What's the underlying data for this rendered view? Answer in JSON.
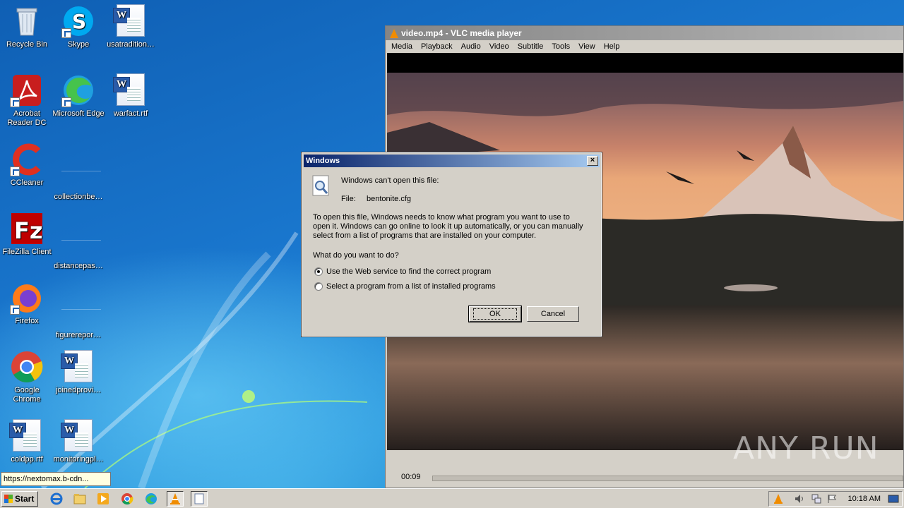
{
  "desktop": {
    "icons": [
      {
        "label": "Recycle Bin",
        "icon": "recycle-bin-icon"
      },
      {
        "label": "Skype",
        "icon": "skype-icon"
      },
      {
        "label": "usatradition…",
        "icon": "word-document-icon"
      },
      {
        "label": "Acrobat Reader DC",
        "icon": "acrobat-icon"
      },
      {
        "label": "Microsoft Edge",
        "icon": "edge-icon"
      },
      {
        "label": "warfact.rtf",
        "icon": "word-document-icon"
      },
      {
        "label": "CCleaner",
        "icon": "ccleaner-icon"
      },
      {
        "label": "collectionbe…",
        "icon": "blank-file-icon"
      },
      {
        "label": "FileZilla Client",
        "icon": "filezilla-icon"
      },
      {
        "label": "distancepas…",
        "icon": "blank-file-icon"
      },
      {
        "label": "Firefox",
        "icon": "firefox-icon"
      },
      {
        "label": "figurerepor…",
        "icon": "blank-file-icon"
      },
      {
        "label": "Google Chrome",
        "icon": "chrome-icon"
      },
      {
        "label": "joinedprovi…",
        "icon": "word-document-icon"
      },
      {
        "label": "coldpp.rtf",
        "icon": "word-document-icon"
      },
      {
        "label": "monitoringpl…",
        "icon": "word-document-icon"
      }
    ]
  },
  "vlc": {
    "title": "video.mp4 - VLC media player",
    "menu": [
      "Media",
      "Playback",
      "Audio",
      "Video",
      "Subtitle",
      "Tools",
      "View",
      "Help"
    ],
    "time": "00:09"
  },
  "dialog": {
    "title": "Windows",
    "heading": "Windows can't open this file:",
    "file_label": "File:",
    "file_name": "bentonite.cfg",
    "body": "To open this file, Windows needs to know what program you want to use to open it. Windows can go online to look it up automatically, or you can manually select from a list of programs that are installed on your computer.",
    "question": "What do you want to do?",
    "option_web": "Use the Web service to find the correct program",
    "option_list": "Select a program from a list of installed programs",
    "ok": "OK",
    "cancel": "Cancel",
    "close": "×"
  },
  "tooltip": "https://nextomax.b-cdn...",
  "watermark": "ANY RUN",
  "taskbar": {
    "start": "Start",
    "clock": "10:18 AM"
  },
  "colors": {
    "dialog_title_start": "#0a246a",
    "dialog_title_end": "#a6caf0",
    "desktop": "#1a78cf",
    "vlc_orange": "#f08c00"
  }
}
